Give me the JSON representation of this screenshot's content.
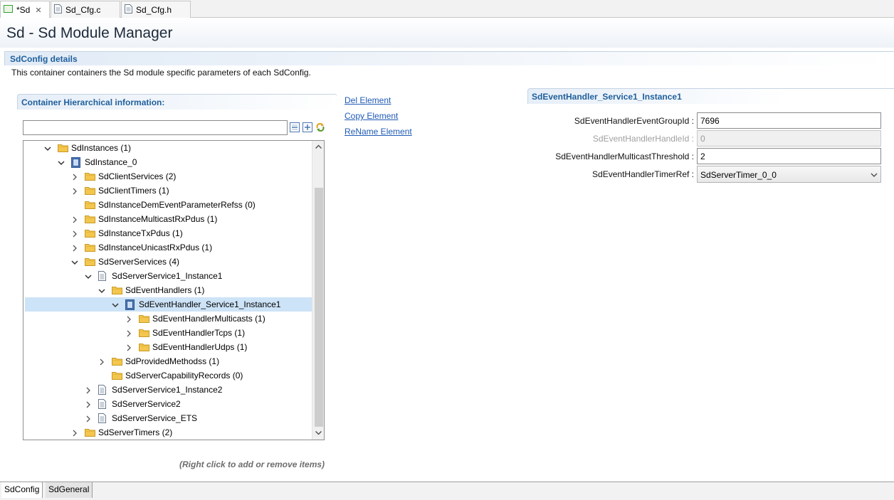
{
  "editor_tabs": [
    {
      "label": "*Sd",
      "icon": "component-icon",
      "active": true
    },
    {
      "label": "Sd_Cfg.c",
      "icon": "file-icon",
      "active": false
    },
    {
      "label": "Sd_Cfg.h",
      "icon": "file-icon",
      "active": false
    }
  ],
  "page_title": "Sd - Sd Module Manager",
  "section": {
    "title": "SdConfig details",
    "description": "This container containers the Sd module specific parameters of each SdConfig."
  },
  "hierarchy": {
    "title": "Container Hierarchical information:",
    "filter_value": "",
    "hint": "(Right click to add or remove items)"
  },
  "actions": {
    "delete": "Del Element",
    "copy": "Copy Element",
    "rename": "ReName Element"
  },
  "tree": [
    {
      "label": "SdInstances (1)",
      "icon": "folder-icon",
      "expander": "expanded"
    },
    {
      "label": "SdInstance_0",
      "icon": "container-icon",
      "expander": "expanded"
    },
    {
      "label": "SdClientServices (2)",
      "icon": "folder-icon",
      "expander": "collapsed"
    },
    {
      "label": "SdClientTimers (1)",
      "icon": "folder-icon",
      "expander": "collapsed"
    },
    {
      "label": "SdInstanceDemEventParameterRefss (0)",
      "icon": "folder-icon",
      "expander": "none"
    },
    {
      "label": "SdInstanceMulticastRxPdus (1)",
      "icon": "folder-icon",
      "expander": "collapsed"
    },
    {
      "label": "SdInstanceTxPdus (1)",
      "icon": "folder-icon",
      "expander": "collapsed"
    },
    {
      "label": "SdInstanceUnicastRxPdus (1)",
      "icon": "folder-icon",
      "expander": "collapsed"
    },
    {
      "label": "SdServerServices (4)",
      "icon": "folder-icon",
      "expander": "expanded"
    },
    {
      "label": "SdServerService1_Instance1",
      "icon": "document-icon",
      "expander": "expanded"
    },
    {
      "label": "SdEventHandlers (1)",
      "icon": "folder-icon",
      "expander": "expanded"
    },
    {
      "label": "SdEventHandler_Service1_Instance1",
      "icon": "container-icon",
      "expander": "expanded",
      "selected": true
    },
    {
      "label": "SdEventHandlerMulticasts (1)",
      "icon": "folder-icon",
      "expander": "collapsed"
    },
    {
      "label": "SdEventHandlerTcps (1)",
      "icon": "folder-icon",
      "expander": "collapsed"
    },
    {
      "label": "SdEventHandlerUdps (1)",
      "icon": "folder-icon",
      "expander": "collapsed"
    },
    {
      "label": "SdProvidedMethodss (1)",
      "icon": "folder-icon",
      "expander": "collapsed"
    },
    {
      "label": "SdServerCapabilityRecords (0)",
      "icon": "folder-icon",
      "expander": "none"
    },
    {
      "label": "SdServerService1_Instance2",
      "icon": "document-icon",
      "expander": "collapsed"
    },
    {
      "label": "SdServerService2",
      "icon": "document-icon",
      "expander": "collapsed"
    },
    {
      "label": "SdServerService_ETS",
      "icon": "document-icon",
      "expander": "collapsed"
    },
    {
      "label": "SdServerTimers (2)",
      "icon": "folder-icon",
      "expander": "collapsed"
    }
  ],
  "details": {
    "title": "SdEventHandler_Service1_Instance1",
    "fields": [
      {
        "label": "SdEventHandlerEventGroupId :",
        "value": "7696",
        "kind": "text",
        "enabled": true
      },
      {
        "label": "SdEventHandlerHandleId :",
        "value": "0",
        "kind": "text",
        "enabled": false
      },
      {
        "label": "SdEventHandlerMulticastThreshold :",
        "value": "2",
        "kind": "text",
        "enabled": true
      },
      {
        "label": "SdEventHandlerTimerRef :",
        "value": "SdServerTimer_0_0",
        "kind": "select",
        "enabled": true
      }
    ]
  },
  "bottom_tabs": [
    {
      "label": "SdConfig",
      "active": true
    },
    {
      "label": "SdGeneral",
      "active": false
    }
  ],
  "colors": {
    "accent": "#1f5f9b",
    "link": "#1f5bb5",
    "selection": "#cde3f7",
    "folder": "#f3c64e"
  }
}
